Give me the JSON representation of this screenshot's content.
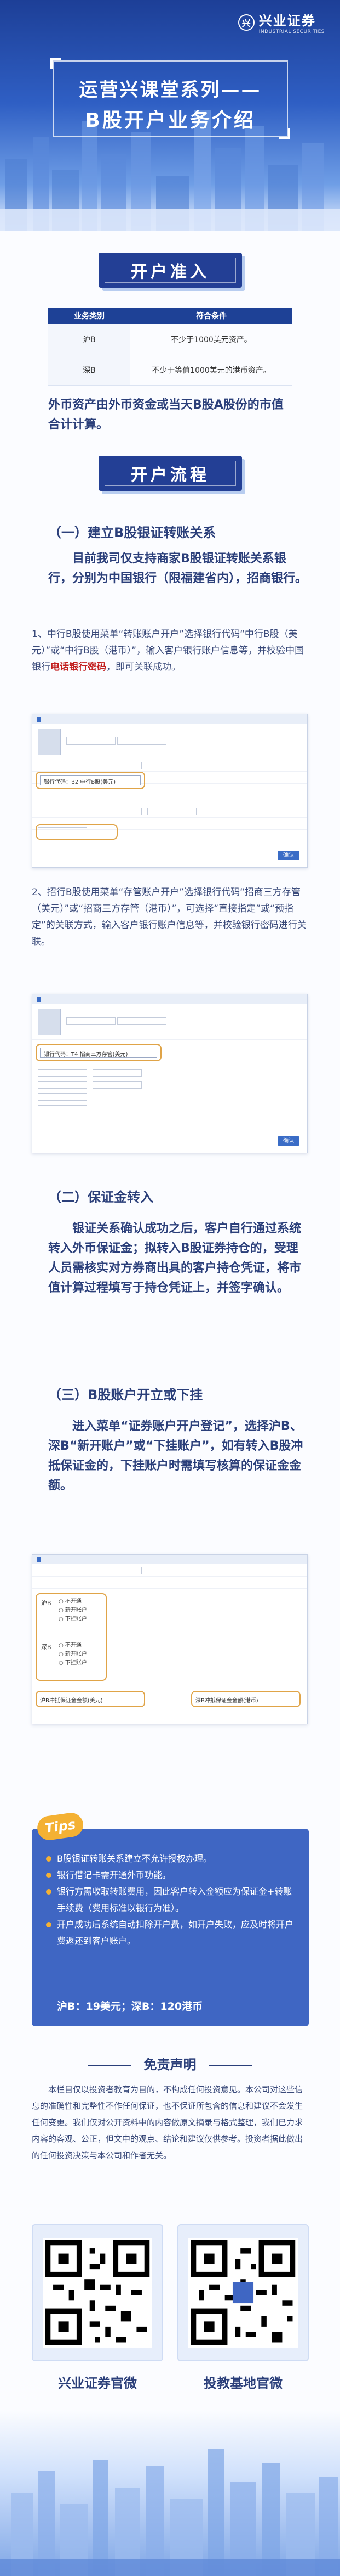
{
  "brand": {
    "logo_text": "兴业证券",
    "logo_sub": "INDUSTRIAL SECURITIES",
    "logo_mark": "兴"
  },
  "hero": {
    "series": "运营兴课堂系列——",
    "title": "B股开户业务介绍"
  },
  "section1": {
    "title": "开户准入",
    "table": {
      "headers": [
        "业务类别",
        "符合条件"
      ],
      "rows": [
        [
          "沪B",
          "不少于1000美元资产。"
        ],
        [
          "深B",
          "不少于等值1000美元的港币资产。"
        ]
      ]
    },
    "note": "外币资产由外币资金或当天B股A股份的市值合计计算。"
  },
  "section2": {
    "title": "开户流程",
    "sub1": "（一）建立B股银证转账关系",
    "intro": "目前我司仅支持商家B股银证转账关系银行，分别为中国银行（限福建省内），招商银行。",
    "step1_a": "1、中行B股使用菜单“转账账户开户”选择银行代码“中行B股（美元）”或“中行B股（港币）”，输入客户银行账户信息等，并校验中国银行",
    "step1_b": "电话银行密码",
    "step1_c": "，即可关联成功。",
    "shot1": {
      "select_label": "银行代码",
      "select_value": "B2 中行B股(美元)",
      "button": "确认"
    },
    "step2": "2、招行B股使用菜单“存管账户开户”选择银行代码“招商三方存管（美元）”或“招商三方存管（港币）”，可选择“直接指定”或“预指定”的关联方式，输入客户银行账户信息等，并校验银行密码进行关联。",
    "shot2": {
      "select_label": "银行代码",
      "select_value": "T4 招商三方存管(美元)",
      "button": "确认"
    },
    "sub2": "（二）保证金转入",
    "deposit": "银证关系确认成功之后，客户自行通过系统转入外币保证金；拟转入B股证券持仓的，受理人员需核实对方券商出具的客户持仓凭证，将市值计算过程填写于持仓凭证上，并签字确认。",
    "sub3": "（三）B股账户开立或下挂",
    "account": "进入菜单“证券账户开户登记”，选择沪B、深B“新开账户”或“下挂账户”，如有转入B股冲抵保证金的，下挂账户时需填写核算的保证金金额。",
    "shot3": {
      "sh_label": "沪B",
      "sz_label": "深B",
      "options": [
        "不开通",
        "新开账户",
        "下挂账户"
      ],
      "amount_left": "沪B冲抵保证金金额(美元)",
      "amount_right": "深B冲抵保证金金额(港币)"
    }
  },
  "tips": {
    "tag": "Tips",
    "items": [
      "B股银证转账关系建立不允许授权办理。",
      "银行借记卡需开通外币功能。",
      "银行方需收取转账费用，因此客户转入金额应为保证金+转账手续费（费用标准以银行为准）。",
      "开户成功后系统自动扣除开户费，如开户失败，应及时将开户费返还到客户账户。"
    ],
    "rates": "沪B：19美元；深B：120港币"
  },
  "disclaimer": {
    "title": "免责声明",
    "text": "本栏目仅以投资者教育为目的，不构成任何投资意见。本公司对这些信息的准确性和完整性不作任何保证，也不保证所包含的信息和建议不会发生任何变更。我们仅对公开资料中的内容做原文摘录与格式整理，我们已力求内容的客观、公正，但文中的观点、结论和建议仅供参考。投资者据此做出的任何投资决策与本公司和作者无关。"
  },
  "qrcodes": [
    {
      "label": "兴业证券官微"
    },
    {
      "label": "投教基地官微"
    }
  ],
  "colors": {
    "primary": "#233f95",
    "accent": "#f4b133",
    "highlight": "#c21f1f"
  }
}
